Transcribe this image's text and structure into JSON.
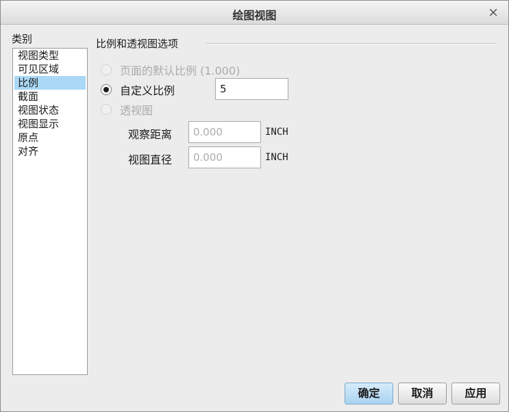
{
  "dialog": {
    "title": "绘图视图",
    "close_glyph": "×"
  },
  "categories": {
    "label": "类别",
    "items": [
      "视图类型",
      "可见区域",
      "比例",
      "截面",
      "视图状态",
      "视图显示",
      "原点",
      "对齐"
    ],
    "selected": "比例"
  },
  "scale_group": {
    "label": "比例和透视图选项",
    "options": [
      {
        "label": "页面的默认比例 (1.000)",
        "checked": false,
        "enabled": false
      },
      {
        "label": "自定义比例",
        "checked": true,
        "enabled": true
      },
      {
        "label": "透视图",
        "checked": false,
        "enabled": false
      }
    ],
    "custom_scale_value": "5",
    "view_distance": {
      "label": "观察距离",
      "placeholder": "0.000",
      "unit": "INCH"
    },
    "view_diameter": {
      "label": "视图直径",
      "placeholder": "0.000",
      "unit": "INCH"
    }
  },
  "buttons": {
    "ok": "确定",
    "cancel": "取消",
    "apply": "应用"
  },
  "colors": {
    "selection": "#aad8f6",
    "primary_button": "#a9d2f0",
    "disabled_text": "#ababab"
  }
}
